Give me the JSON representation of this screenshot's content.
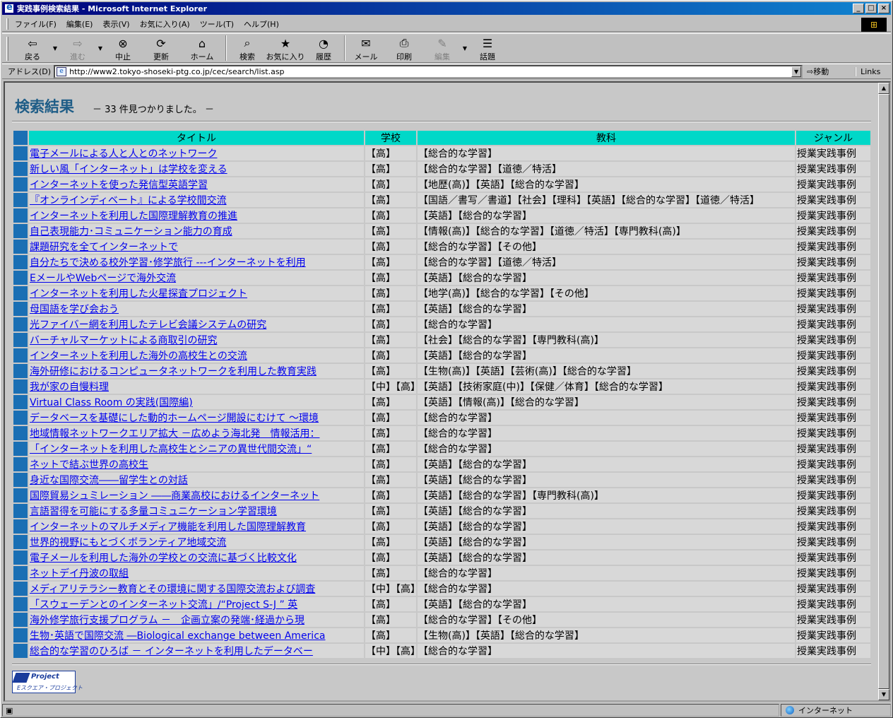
{
  "window": {
    "title": "実践事例検索結果 - Microsoft Internet Explorer"
  },
  "menu": [
    "ファイル(F)",
    "編集(E)",
    "表示(V)",
    "お気に入り(A)",
    "ツール(T)",
    "ヘルプ(H)"
  ],
  "toolbar": {
    "back": "戻る",
    "forward": "進む",
    "stop": "中止",
    "refresh": "更新",
    "home": "ホーム",
    "search": "検索",
    "favorites": "お気に入り",
    "history": "履歴",
    "mail": "メール",
    "print": "印刷",
    "edit": "編集",
    "discuss": "話題"
  },
  "address": {
    "label": "アドレス(D)",
    "url": "http://www2.tokyo-shoseki-ptg.co.jp/cec/search/list.asp",
    "go": "移動",
    "links": "Links"
  },
  "page": {
    "title": "検索結果",
    "count_text": "－ 33 件見つかりました。 －",
    "logo_text": "Project",
    "logo_sub": "Eスクエア・プロジェクト"
  },
  "table": {
    "headers": [
      "タイトル",
      "学校",
      "教科",
      "ジャンル"
    ],
    "rows": [
      [
        "電子メールによる人と人とのネットワーク",
        "【高】",
        "【総合的な学習】",
        "授業実践事例"
      ],
      [
        "新しい風「インターネット」は学校を変える",
        "【高】",
        "【総合的な学習】【道徳／特活】",
        "授業実践事例"
      ],
      [
        "インターネットを使った発信型英語学習",
        "【高】",
        "【地歴(高)】【英語】【総合的な学習】",
        "授業実践事例"
      ],
      [
        "『オンラインディベート』による学校間交流",
        "【高】",
        "【国語／書写／書道】【社会】【理科】【英語】【総合的な学習】【道徳／特活】",
        "授業実践事例"
      ],
      [
        "インターネットを利用した国際理解教育の推進",
        "【高】",
        "【英語】【総合的な学習】",
        "授業実践事例"
      ],
      [
        "自己表現能力･コミュニケーション能力の育成",
        "【高】",
        "【情報(高)】【総合的な学習】【道徳／特活】【専門教科(高)】",
        "授業実践事例"
      ],
      [
        "課題研究を全てインターネットで",
        "【高】",
        "【総合的な学習】【その他】",
        "授業実践事例"
      ],
      [
        "自分たちで決める校外学習･修学旅行 ---インターネットを利用",
        "【高】",
        "【総合的な学習】【道徳／特活】",
        "授業実践事例"
      ],
      [
        "EメールやWebページで海外交流",
        "【高】",
        "【英語】【総合的な学習】",
        "授業実践事例"
      ],
      [
        "インターネットを利用した火星探査プロジェクト",
        "【高】",
        "【地学(高)】【総合的な学習】【その他】",
        "授業実践事例"
      ],
      [
        "母国語を学び会おう",
        "【高】",
        "【英語】【総合的な学習】",
        "授業実践事例"
      ],
      [
        "光ファイバー網を利用したテレビ会議システムの研究",
        "【高】",
        "【総合的な学習】",
        "授業実践事例"
      ],
      [
        "バーチャルマーケットによる商取引の研究",
        "【高】",
        "【社会】【総合的な学習】【専門教科(高)】",
        "授業実践事例"
      ],
      [
        "インターネットを利用した海外の高校生との交流",
        "【高】",
        "【英語】【総合的な学習】",
        "授業実践事例"
      ],
      [
        "海外研修におけるコンピュータネットワークを利用した教育実践",
        "【高】",
        "【生物(高)】【英語】【芸術(高)】【総合的な学習】",
        "授業実践事例"
      ],
      [
        "我が家の自慢料理",
        "【中】【高】",
        "【英語】【技術家庭(中)】【保健／体育】【総合的な学習】",
        "授業実践事例"
      ],
      [
        "Virtual Class Room の実践(国際編)",
        "【高】",
        "【英語】【情報(高)】【総合的な学習】",
        "授業実践事例"
      ],
      [
        "データベースを基礎にした動的ホームページ開設にむけて ～環境",
        "【高】",
        "【総合的な学習】",
        "授業実践事例"
      ],
      [
        "地域情報ネットワークエリア拡大 －広めよう海北発　情報活用：",
        "【高】",
        "【総合的な学習】",
        "授業実践事例"
      ],
      [
        "「インターネットを利用した高校生とシニアの異世代間交流」“",
        "【高】",
        "【総合的な学習】",
        "授業実践事例"
      ],
      [
        "ネットで結ぶ世界の高校生",
        "【高】",
        "【英語】【総合的な学習】",
        "授業実践事例"
      ],
      [
        "身近な国際交流――留学生との対話",
        "【高】",
        "【英語】【総合的な学習】",
        "授業実践事例"
      ],
      [
        "国際貿易シュミレーション ――商業高校におけるインターネット",
        "【高】",
        "【英語】【総合的な学習】【専門教科(高)】",
        "授業実践事例"
      ],
      [
        "言語習得を可能にする多量コミュニケーション学習環境",
        "【高】",
        "【英語】【総合的な学習】",
        "授業実践事例"
      ],
      [
        "インターネットのマルチメディア機能を利用した国際理解教育",
        "【高】",
        "【英語】【総合的な学習】",
        "授業実践事例"
      ],
      [
        "世界的視野にもとづくボランティア地域交流",
        "【高】",
        "【英語】【総合的な学習】",
        "授業実践事例"
      ],
      [
        "電子メールを利用した海外の学校との交流に基づく比較文化",
        "【高】",
        "【英語】【総合的な学習】",
        "授業実践事例"
      ],
      [
        "ネットデイ丹波の取組",
        "【高】",
        "【総合的な学習】",
        "授業実践事例"
      ],
      [
        "メディアリテラシー教育とその環境に関する国際交流および調査",
        "【中】【高】",
        "【総合的な学習】",
        "授業実践事例"
      ],
      [
        "「スウェーデンとのインターネット交流」/“Project S-J ” 英",
        "【高】",
        "【英語】【総合的な学習】",
        "授業実践事例"
      ],
      [
        "海外修学旅行支援プログラム －　企画立案の発端･経過から現",
        "【高】",
        "【総合的な学習】【その他】",
        "授業実践事例"
      ],
      [
        "生物･英語で国際交流 ―Biological exchange between America",
        "【高】",
        "【生物(高)】【英語】【総合的な学習】",
        "授業実践事例"
      ],
      [
        "総合的な学習のひろば － インターネットを利用したデータベー",
        "【中】【高】",
        "【総合的な学習】",
        "授業実践事例"
      ]
    ]
  },
  "status": {
    "left": "",
    "zone": "インターネット"
  }
}
